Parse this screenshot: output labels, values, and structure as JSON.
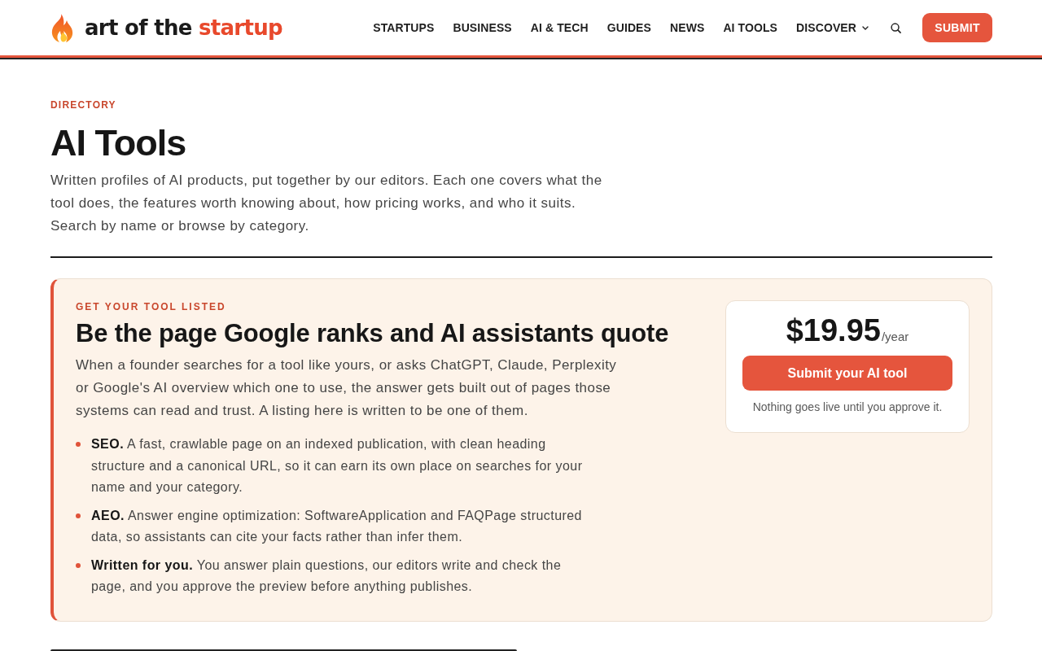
{
  "header": {
    "logo": {
      "text": "art of the",
      "accent": "startup"
    },
    "nav": [
      {
        "label": "STARTUPS",
        "kind": "link"
      },
      {
        "label": "BUSINESS",
        "kind": "link"
      },
      {
        "label": "AI & TECH",
        "kind": "link"
      },
      {
        "label": "GUIDES",
        "kind": "link"
      },
      {
        "label": "NEWS",
        "kind": "link"
      },
      {
        "label": "AI TOOLS",
        "kind": "link"
      },
      {
        "label": "DISCOVER",
        "kind": "dropdown"
      }
    ],
    "submit_button": "SUBMIT"
  },
  "intro": {
    "eyebrow": "DIRECTORY",
    "title": "AI Tools",
    "description": "Written profiles of AI products, put together by our editors. Each one covers what the tool does, the features worth knowing about, how pricing works, and who it suits. Search by name or browse by category."
  },
  "promo": {
    "eyebrow": "GET YOUR TOOL LISTED",
    "title": "Be the page Google ranks and AI assistants quote",
    "body": "When a founder searches for a tool like yours, or asks ChatGPT, Claude, Perplexity or Google's AI overview which one to use, the answer gets built out of pages those systems can read and trust. A listing here is written to be one of them.",
    "points": [
      "**SEO.** A fast, crawlable page on an indexed publication, with clean heading structure and a canonical URL, so it can earn its own place on searches for your name and your category.",
      "**AEO.** Answer engine optimization: SoftwareApplication and FAQPage structured data, so assistants can cite your facts rather than infer them.",
      "**Written for you.** You answer plain questions, our editors write and check the page, and you approve the preview before anything publishes."
    ],
    "pricing": {
      "price": "$19.95",
      "period": "/year",
      "button": "Submit your AI tool",
      "note": "Nothing goes live until you approve it."
    }
  }
}
